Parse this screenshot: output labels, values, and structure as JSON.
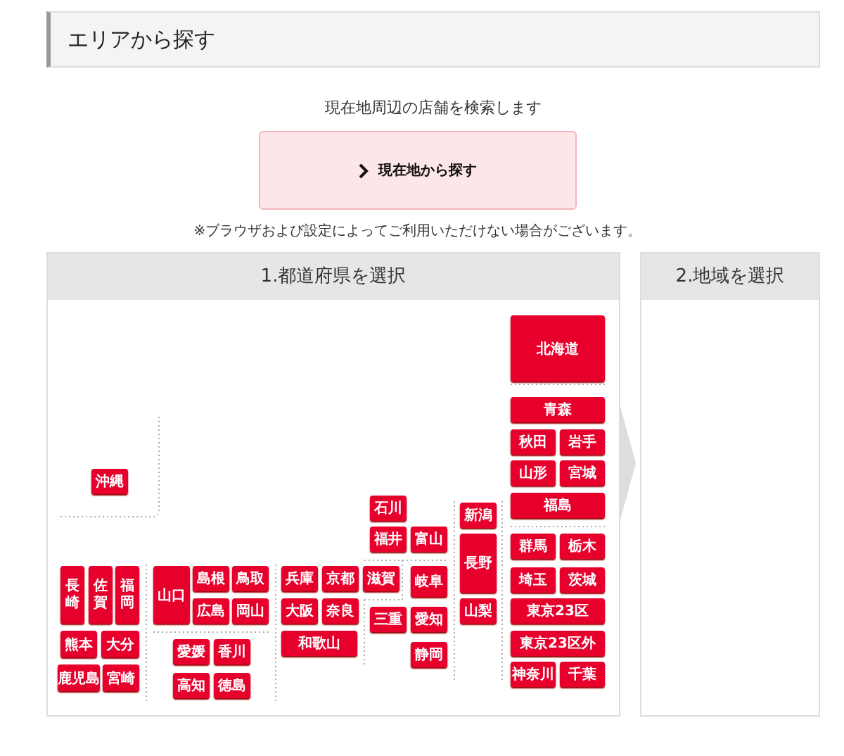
{
  "section_title": "エリアから探す",
  "lead": "現在地周辺の店舗を検索します",
  "locate_button": {
    "label": "現在地から探す"
  },
  "note": "※ブラウザおよび設定によってご利用いただけない場合がございます。",
  "steps": [
    {
      "title": "1.都道府県を選択"
    },
    {
      "title": "2.地域を選択"
    }
  ],
  "prefectures": [
    {
      "label": "北海道",
      "kind": "horizontal"
    },
    {
      "label": "青森",
      "kind": "horizontal"
    },
    {
      "label": "秋田",
      "kind": "horizontal"
    },
    {
      "label": "岩手",
      "kind": "horizontal"
    },
    {
      "label": "山形",
      "kind": "horizontal"
    },
    {
      "label": "宮城",
      "kind": "horizontal"
    },
    {
      "label": "福島",
      "kind": "horizontal"
    },
    {
      "label": "沖縄",
      "kind": "horizontal"
    },
    {
      "label": "石川",
      "kind": "horizontal"
    },
    {
      "label": "新潟",
      "kind": "horizontal"
    },
    {
      "label": "福井",
      "kind": "horizontal"
    },
    {
      "label": "富山",
      "kind": "horizontal"
    },
    {
      "label": "長野",
      "kind": "horizontal"
    },
    {
      "label": "群馬",
      "kind": "horizontal"
    },
    {
      "label": "栃木",
      "kind": "horizontal"
    },
    {
      "label": "長崎",
      "kind": "vertical"
    },
    {
      "label": "佐賀",
      "kind": "vertical"
    },
    {
      "label": "福岡",
      "kind": "vertical"
    },
    {
      "label": "山口",
      "kind": "horizontal"
    },
    {
      "label": "島根",
      "kind": "horizontal"
    },
    {
      "label": "鳥取",
      "kind": "horizontal"
    },
    {
      "label": "兵庫",
      "kind": "horizontal"
    },
    {
      "label": "京都",
      "kind": "horizontal"
    },
    {
      "label": "滋賀",
      "kind": "horizontal"
    },
    {
      "label": "岐阜",
      "kind": "horizontal"
    },
    {
      "label": "埼玉",
      "kind": "horizontal"
    },
    {
      "label": "茨城",
      "kind": "horizontal"
    },
    {
      "label": "広島",
      "kind": "horizontal"
    },
    {
      "label": "岡山",
      "kind": "horizontal"
    },
    {
      "label": "大阪",
      "kind": "horizontal"
    },
    {
      "label": "奈良",
      "kind": "horizontal"
    },
    {
      "label": "三重",
      "kind": "horizontal"
    },
    {
      "label": "愛知",
      "kind": "horizontal"
    },
    {
      "label": "山梨",
      "kind": "horizontal"
    },
    {
      "label": "東京23区",
      "kind": "horizontal"
    },
    {
      "label": "熊本",
      "kind": "horizontal"
    },
    {
      "label": "大分",
      "kind": "horizontal"
    },
    {
      "label": "愛媛",
      "kind": "horizontal"
    },
    {
      "label": "香川",
      "kind": "horizontal"
    },
    {
      "label": "和歌山",
      "kind": "horizontal"
    },
    {
      "label": "東京23区外",
      "kind": "horizontal"
    },
    {
      "label": "静岡",
      "kind": "horizontal"
    },
    {
      "label": "鹿児島",
      "kind": "horizontal"
    },
    {
      "label": "宮崎",
      "kind": "horizontal"
    },
    {
      "label": "高知",
      "kind": "horizontal"
    },
    {
      "label": "徳島",
      "kind": "horizontal"
    },
    {
      "label": "神奈川",
      "kind": "horizontal"
    },
    {
      "label": "千葉",
      "kind": "horizontal"
    }
  ]
}
